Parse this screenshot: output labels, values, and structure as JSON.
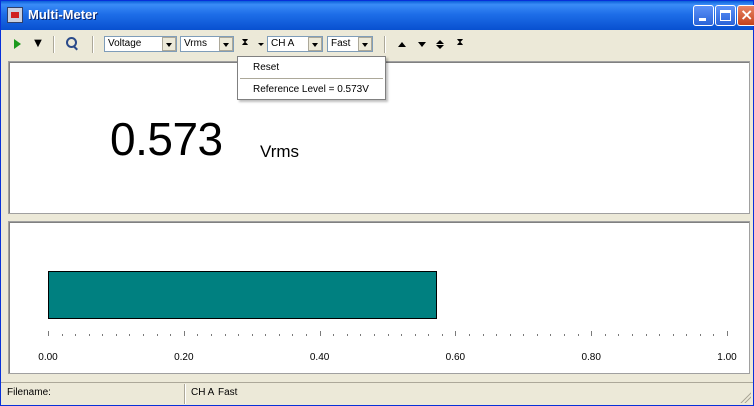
{
  "window": {
    "title": "Multi-Meter"
  },
  "toolbar": {
    "measure_select": "Voltage",
    "units_select": "Vrms",
    "channel_select": "CH A",
    "speed_select": "Fast"
  },
  "menu": {
    "items": [
      "Reset",
      "Reference Level = 0.573V"
    ]
  },
  "reading": {
    "value": "0.573",
    "unit": "Vrms"
  },
  "bargraph": {
    "level_fraction": 0.573,
    "scale_labels": [
      "0.00",
      "0.20",
      "0.40",
      "0.60",
      "0.80",
      "1.00"
    ],
    "bar_color": "#008080"
  },
  "statusbar": {
    "filename_label": "Filename:",
    "channel": "CH A",
    "speed": "Fast"
  }
}
